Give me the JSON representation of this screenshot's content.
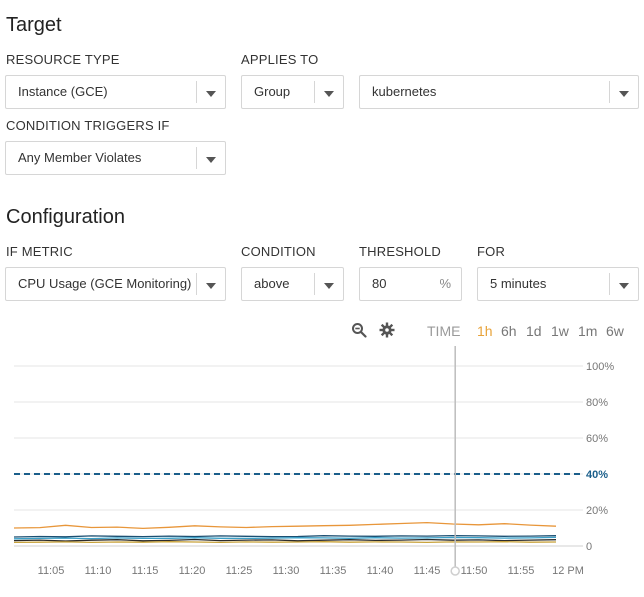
{
  "target": {
    "heading": "Target",
    "resource_type_label": "RESOURCE TYPE",
    "resource_type_value": "Instance (GCE)",
    "applies_to_label": "APPLIES TO",
    "applies_to_value": "Group",
    "group_value": "kubernetes",
    "condition_triggers_label": "CONDITION TRIGGERS IF",
    "condition_triggers_value": "Any Member Violates"
  },
  "configuration": {
    "heading": "Configuration",
    "metric_label": "IF METRIC",
    "metric_value": "CPU Usage (GCE Monitoring)",
    "condition_label": "CONDITION",
    "condition_value": "above",
    "threshold_label": "THRESHOLD",
    "threshold_value": "80",
    "threshold_unit": "%",
    "for_label": "FOR",
    "for_value": "5 minutes"
  },
  "toolbar": {
    "time_label": "TIME",
    "ranges": [
      "1h",
      "6h",
      "1d",
      "1w",
      "1m",
      "6w"
    ],
    "selected_range": "1h",
    "selected_color": "#e8a33a",
    "icons": [
      "zoom-out-icon",
      "gear-icon"
    ]
  },
  "chart_data": {
    "type": "line",
    "x": [
      "11:05",
      "11:10",
      "11:15",
      "11:20",
      "11:25",
      "11:30",
      "11:35",
      "11:40",
      "11:45",
      "11:50",
      "11:55",
      "12 PM"
    ],
    "ylim": [
      0,
      100
    ],
    "yticks": [
      "0",
      "20%",
      "40%",
      "60%",
      "80%",
      "100%"
    ],
    "threshold_line": {
      "value": 40,
      "label": "40%",
      "color": "#1a5e8a"
    },
    "cursor_time": "11:48",
    "series": [
      {
        "color": "#e8963a",
        "values": [
          10,
          10.2,
          11.5,
          10.3,
          10.5,
          9.8,
          10.4,
          11.2,
          10.6,
          10.3,
          10.8,
          11.0,
          11.3,
          11.5,
          12.0,
          12.5,
          13.0,
          12.2,
          11.8,
          12.4,
          11.6,
          11.0
        ]
      },
      {
        "color": "#1b4f72",
        "values": [
          5,
          5.3,
          5.1,
          5.6,
          5.4,
          5.2,
          5.5,
          5.3,
          5.6,
          5.4,
          5.2,
          5.3,
          5.7,
          5.5,
          5.4,
          5.6,
          5.5,
          5.8,
          5.6,
          5.4,
          5.5,
          5.7
        ]
      },
      {
        "color": "#3aa0c8",
        "values": [
          4,
          4.2,
          4.4,
          4.1,
          4.5,
          4.2,
          4.3,
          4.6,
          4.3,
          4.2,
          4.4,
          4.6,
          4.5,
          4.3,
          4.6,
          4.4,
          4.5,
          4.7,
          4.6,
          4.4,
          4.5,
          4.8
        ]
      },
      {
        "color": "#2c2c2c",
        "values": [
          3,
          3.3,
          2.8,
          3.2,
          3.5,
          2.9,
          3.1,
          3.6,
          3.0,
          3.3,
          3.4,
          2.9,
          3.2,
          3.5,
          3.1,
          3.3,
          3.6,
          3.2,
          3.4,
          3.0,
          3.3,
          3.5
        ]
      },
      {
        "color": "#c8a23a",
        "values": [
          2,
          2.1,
          2.3,
          2.0,
          2.2,
          2.1,
          2.4,
          2.2,
          2.0,
          2.3,
          2.1,
          2.2,
          2.4,
          2.1,
          2.3,
          2.2,
          2.0,
          2.3,
          2.2,
          2.4,
          2.1,
          2.2
        ]
      }
    ]
  }
}
